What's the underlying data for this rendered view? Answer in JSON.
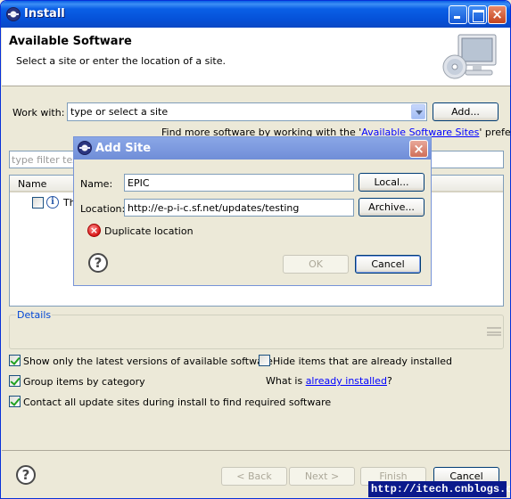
{
  "window": {
    "title": "Install",
    "close_glyph": "×"
  },
  "header": {
    "title": "Available Software",
    "subtitle": "Select a site or enter the location of a site."
  },
  "work_with": {
    "label": "Work with:",
    "value": "type or select a site",
    "add_button": "Add...",
    "find_more_prefix": "Find more software by working with the '",
    "find_more_link": "Available Software Sites",
    "find_more_suffix": "' preferences."
  },
  "filter": {
    "placeholder": "type filter text"
  },
  "tree": {
    "column_header": "Name",
    "rows": [
      {
        "text": "Th",
        "checked": false,
        "icon": "info-icon"
      }
    ]
  },
  "details": {
    "legend": "Details"
  },
  "options": {
    "show_latest": {
      "label": "Show only the latest versions of available software",
      "checked": true
    },
    "hide_installed": {
      "label": "Hide items that are already installed",
      "checked": false
    },
    "group_by_category": {
      "label": "Group items by category",
      "checked": true
    },
    "what_is_prefix": "What is ",
    "what_is_link": "already installed",
    "what_is_suffix": "?",
    "contact_all": {
      "label": "Contact all update sites during install to find required software",
      "checked": true
    }
  },
  "footer": {
    "help_glyph": "?",
    "back_button": "< Back",
    "next_button": "Next >",
    "finish_button": "Finish",
    "cancel_button": "Cancel"
  },
  "watermark": "http://itech.cnblogs.com/",
  "add_site_dialog": {
    "title": "Add Site",
    "close_glyph": "×",
    "name_label": "Name:",
    "name_value": "EPIC",
    "local_button": "Local...",
    "location_label": "Location:",
    "location_value": "http://e-p-i-c.sf.net/updates/testing",
    "archive_button": "Archive...",
    "error_glyph": "×",
    "error_message": "Duplicate location",
    "help_glyph": "?",
    "ok_button": "OK",
    "cancel_button": "Cancel"
  },
  "colors": {
    "titlebar": "#0a5fe6",
    "dialog_titlebar": "#7b98de",
    "link": "#0000ff",
    "error": "#d81818",
    "window_bg": "#ece9d8"
  }
}
